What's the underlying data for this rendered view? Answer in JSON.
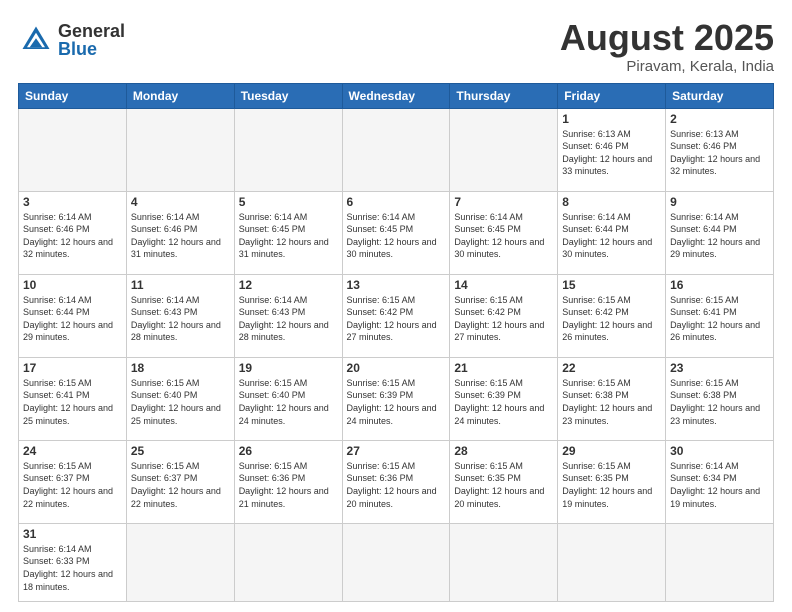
{
  "header": {
    "logo": {
      "general": "General",
      "blue": "Blue"
    },
    "title": "August 2025",
    "subtitle": "Piravam, Kerala, India"
  },
  "calendar": {
    "headers": [
      "Sunday",
      "Monday",
      "Tuesday",
      "Wednesday",
      "Thursday",
      "Friday",
      "Saturday"
    ],
    "rows": [
      [
        {
          "day": "",
          "info": "",
          "empty": true
        },
        {
          "day": "",
          "info": "",
          "empty": true
        },
        {
          "day": "",
          "info": "",
          "empty": true
        },
        {
          "day": "",
          "info": "",
          "empty": true
        },
        {
          "day": "",
          "info": "",
          "empty": true
        },
        {
          "day": "1",
          "info": "Sunrise: 6:13 AM\nSunset: 6:46 PM\nDaylight: 12 hours\nand 33 minutes."
        },
        {
          "day": "2",
          "info": "Sunrise: 6:13 AM\nSunset: 6:46 PM\nDaylight: 12 hours\nand 32 minutes."
        }
      ],
      [
        {
          "day": "3",
          "info": "Sunrise: 6:14 AM\nSunset: 6:46 PM\nDaylight: 12 hours\nand 32 minutes."
        },
        {
          "day": "4",
          "info": "Sunrise: 6:14 AM\nSunset: 6:46 PM\nDaylight: 12 hours\nand 31 minutes."
        },
        {
          "day": "5",
          "info": "Sunrise: 6:14 AM\nSunset: 6:45 PM\nDaylight: 12 hours\nand 31 minutes."
        },
        {
          "day": "6",
          "info": "Sunrise: 6:14 AM\nSunset: 6:45 PM\nDaylight: 12 hours\nand 30 minutes."
        },
        {
          "day": "7",
          "info": "Sunrise: 6:14 AM\nSunset: 6:45 PM\nDaylight: 12 hours\nand 30 minutes."
        },
        {
          "day": "8",
          "info": "Sunrise: 6:14 AM\nSunset: 6:44 PM\nDaylight: 12 hours\nand 30 minutes."
        },
        {
          "day": "9",
          "info": "Sunrise: 6:14 AM\nSunset: 6:44 PM\nDaylight: 12 hours\nand 29 minutes."
        }
      ],
      [
        {
          "day": "10",
          "info": "Sunrise: 6:14 AM\nSunset: 6:44 PM\nDaylight: 12 hours\nand 29 minutes."
        },
        {
          "day": "11",
          "info": "Sunrise: 6:14 AM\nSunset: 6:43 PM\nDaylight: 12 hours\nand 28 minutes."
        },
        {
          "day": "12",
          "info": "Sunrise: 6:14 AM\nSunset: 6:43 PM\nDaylight: 12 hours\nand 28 minutes."
        },
        {
          "day": "13",
          "info": "Sunrise: 6:15 AM\nSunset: 6:42 PM\nDaylight: 12 hours\nand 27 minutes."
        },
        {
          "day": "14",
          "info": "Sunrise: 6:15 AM\nSunset: 6:42 PM\nDaylight: 12 hours\nand 27 minutes."
        },
        {
          "day": "15",
          "info": "Sunrise: 6:15 AM\nSunset: 6:42 PM\nDaylight: 12 hours\nand 26 minutes."
        },
        {
          "day": "16",
          "info": "Sunrise: 6:15 AM\nSunset: 6:41 PM\nDaylight: 12 hours\nand 26 minutes."
        }
      ],
      [
        {
          "day": "17",
          "info": "Sunrise: 6:15 AM\nSunset: 6:41 PM\nDaylight: 12 hours\nand 25 minutes."
        },
        {
          "day": "18",
          "info": "Sunrise: 6:15 AM\nSunset: 6:40 PM\nDaylight: 12 hours\nand 25 minutes."
        },
        {
          "day": "19",
          "info": "Sunrise: 6:15 AM\nSunset: 6:40 PM\nDaylight: 12 hours\nand 24 minutes."
        },
        {
          "day": "20",
          "info": "Sunrise: 6:15 AM\nSunset: 6:39 PM\nDaylight: 12 hours\nand 24 minutes."
        },
        {
          "day": "21",
          "info": "Sunrise: 6:15 AM\nSunset: 6:39 PM\nDaylight: 12 hours\nand 24 minutes."
        },
        {
          "day": "22",
          "info": "Sunrise: 6:15 AM\nSunset: 6:38 PM\nDaylight: 12 hours\nand 23 minutes."
        },
        {
          "day": "23",
          "info": "Sunrise: 6:15 AM\nSunset: 6:38 PM\nDaylight: 12 hours\nand 23 minutes."
        }
      ],
      [
        {
          "day": "24",
          "info": "Sunrise: 6:15 AM\nSunset: 6:37 PM\nDaylight: 12 hours\nand 22 minutes."
        },
        {
          "day": "25",
          "info": "Sunrise: 6:15 AM\nSunset: 6:37 PM\nDaylight: 12 hours\nand 22 minutes."
        },
        {
          "day": "26",
          "info": "Sunrise: 6:15 AM\nSunset: 6:36 PM\nDaylight: 12 hours\nand 21 minutes."
        },
        {
          "day": "27",
          "info": "Sunrise: 6:15 AM\nSunset: 6:36 PM\nDaylight: 12 hours\nand 20 minutes."
        },
        {
          "day": "28",
          "info": "Sunrise: 6:15 AM\nSunset: 6:35 PM\nDaylight: 12 hours\nand 20 minutes."
        },
        {
          "day": "29",
          "info": "Sunrise: 6:15 AM\nSunset: 6:35 PM\nDaylight: 12 hours\nand 19 minutes."
        },
        {
          "day": "30",
          "info": "Sunrise: 6:14 AM\nSunset: 6:34 PM\nDaylight: 12 hours\nand 19 minutes."
        }
      ],
      [
        {
          "day": "31",
          "info": "Sunrise: 6:14 AM\nSunset: 6:33 PM\nDaylight: 12 hours\nand 18 minutes."
        },
        {
          "day": "",
          "info": "",
          "empty": true
        },
        {
          "day": "",
          "info": "",
          "empty": true
        },
        {
          "day": "",
          "info": "",
          "empty": true
        },
        {
          "day": "",
          "info": "",
          "empty": true
        },
        {
          "day": "",
          "info": "",
          "empty": true
        },
        {
          "day": "",
          "info": "",
          "empty": true
        }
      ]
    ]
  }
}
